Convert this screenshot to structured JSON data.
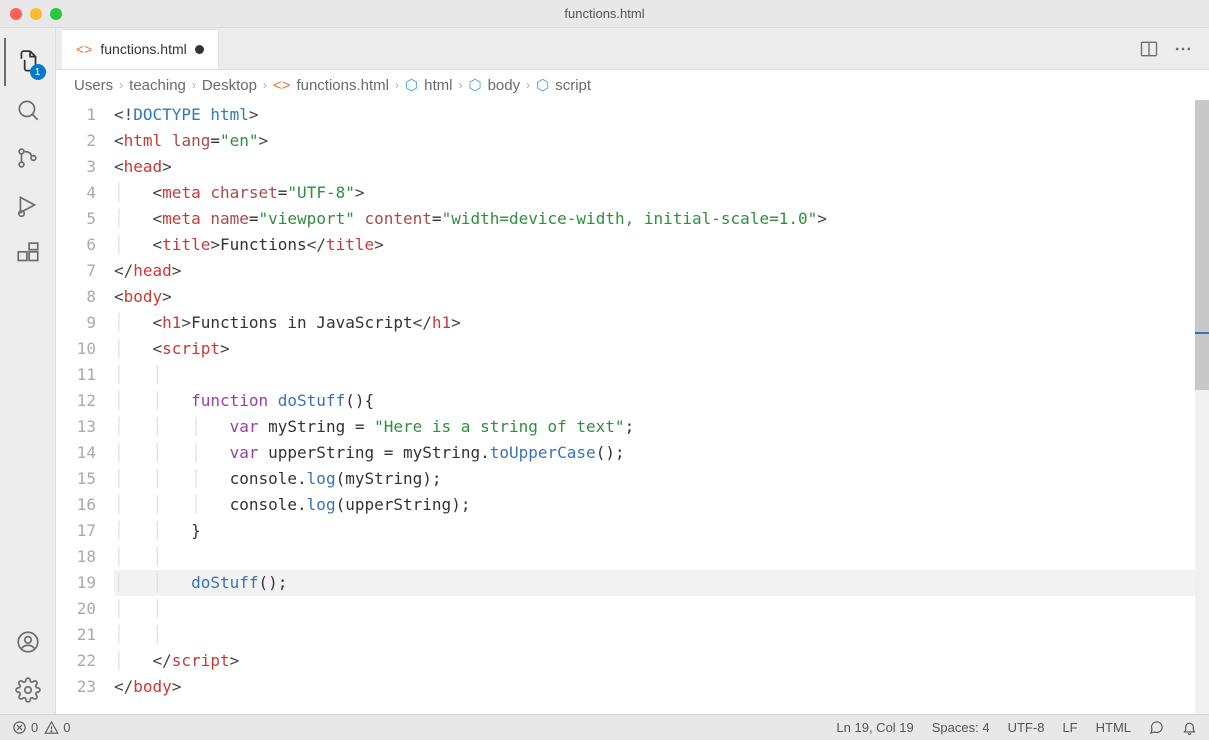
{
  "window": {
    "title": "functions.html"
  },
  "activity": {
    "explorer_badge": "1"
  },
  "tab": {
    "label": "functions.html"
  },
  "breadcrumbs": [
    {
      "label": "Users",
      "icon": "none"
    },
    {
      "label": "teaching",
      "icon": "none"
    },
    {
      "label": "Desktop",
      "icon": "none"
    },
    {
      "label": "functions.html",
      "icon": "file"
    },
    {
      "label": "html",
      "icon": "cube"
    },
    {
      "label": "body",
      "icon": "cube"
    },
    {
      "label": "script",
      "icon": "cube"
    }
  ],
  "code": {
    "doctype": "DOCTYPE html",
    "html_tag": "html",
    "html_attr_lang": "lang",
    "html_lang_val": "\"en\"",
    "head_tag": "head",
    "meta_tag": "meta",
    "charset_attr": "charset",
    "charset_val": "\"UTF-8\"",
    "name_attr": "name",
    "viewport_val": "\"viewport\"",
    "content_attr": "content",
    "content_val": "\"width=device-width, initial-scale=1.0\"",
    "title_tag": "title",
    "title_text": "Functions",
    "body_tag": "body",
    "h1_tag": "h1",
    "h1_text": "Functions in JavaScript",
    "script_tag": "script",
    "kw_function": "function",
    "fn_name": "doStuff",
    "kw_var": "var",
    "var1": "myString",
    "str1": "\"Here is a string of text\"",
    "var2": "upperString",
    "m_upper": "toUpperCase",
    "console": "console",
    "m_log": "log"
  },
  "lines": [
    "1",
    "2",
    "3",
    "4",
    "5",
    "6",
    "7",
    "8",
    "9",
    "10",
    "11",
    "12",
    "13",
    "14",
    "15",
    "16",
    "17",
    "18",
    "19",
    "20",
    "21",
    "22",
    "23"
  ],
  "status": {
    "errors": "0",
    "warnings": "0",
    "cursor": "Ln 19, Col 19",
    "spaces": "Spaces: 4",
    "encoding": "UTF-8",
    "eol": "LF",
    "language": "HTML"
  }
}
